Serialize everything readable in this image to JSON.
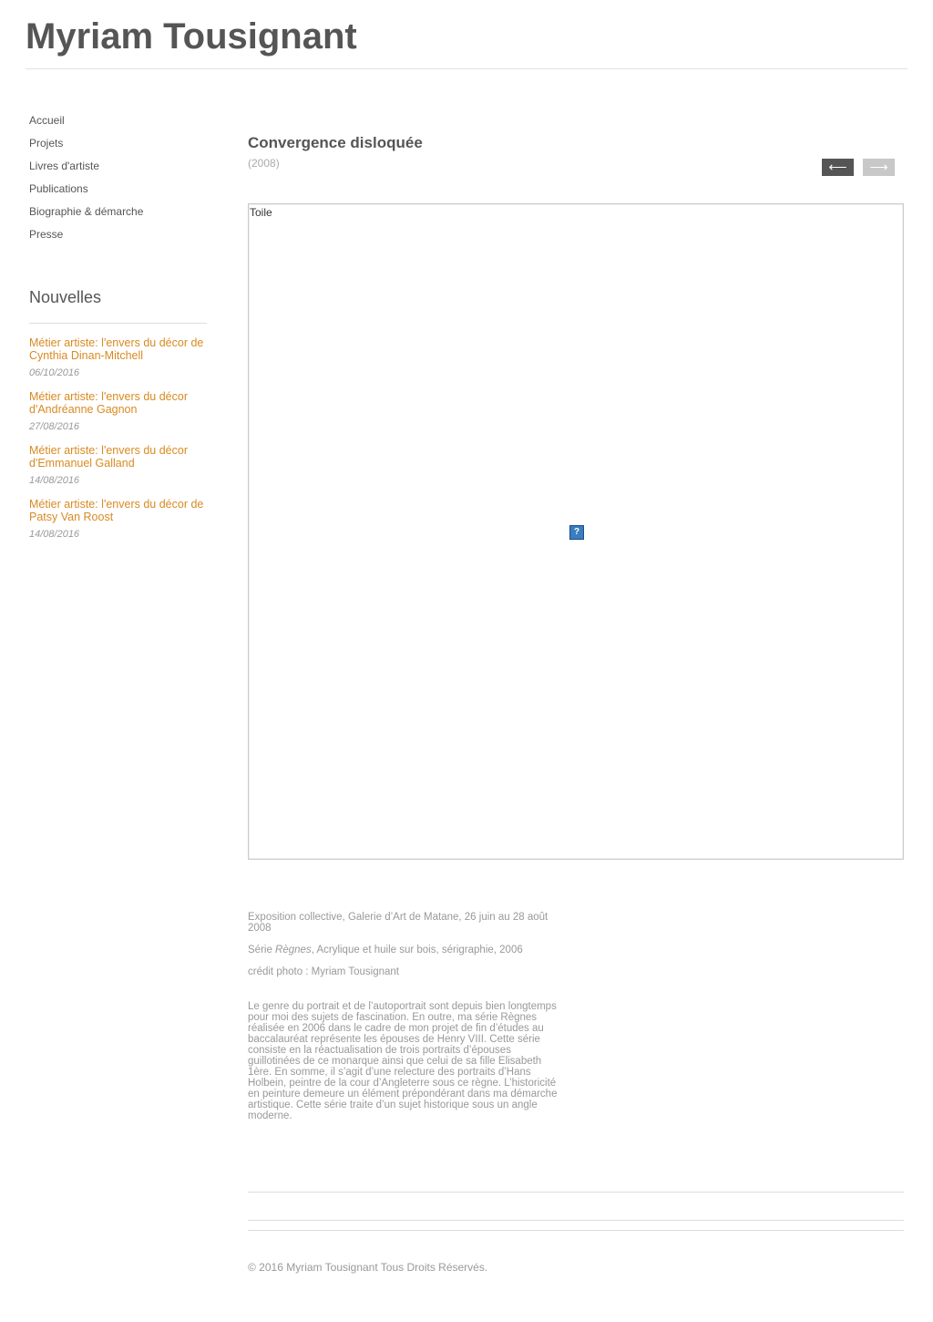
{
  "header": {
    "site_title": "Myriam Tousignant"
  },
  "sidebar": {
    "nav": [
      {
        "label": "Accueil"
      },
      {
        "label": "Projets"
      },
      {
        "label": "Livres d'artiste"
      },
      {
        "label": "Publications"
      },
      {
        "label": "Biographie & démarche"
      },
      {
        "label": "Presse"
      }
    ],
    "news_heading": "Nouvelles",
    "news": [
      {
        "title": "Métier artiste: l'envers du décor de Cynthia Dinan-Mitchell",
        "date": "06/10/2016"
      },
      {
        "title": "Métier artiste: l'envers du décor d'Andréanne Gagnon",
        "date": "27/08/2016"
      },
      {
        "title": "Métier artiste: l'envers du décor d'Emmanuel Galland",
        "date": "14/08/2016"
      },
      {
        "title": "Métier artiste: l'envers du décor de Patsy Van Roost",
        "date": "14/08/2016"
      }
    ]
  },
  "work": {
    "title": "Convergence disloquée",
    "year": "(2008)",
    "prev_arrow": "⟵",
    "next_arrow": "⟶",
    "image_alt": "Toile",
    "broken_image_glyph": "?",
    "exhibition": "Exposition collective, Galerie d’Art de Matane, 26 juin au 28 août 2008",
    "series_prefix": "Série ",
    "series_name": "Règnes",
    "series_suffix": ", Acrylique et huile sur bois, sérigraphie, 2006",
    "credit": "crédit photo : Myriam Tousignant",
    "statement": "Le genre du portrait et de l’autoportrait sont depuis bien longtemps pour moi des sujets de fascination. En outre, ma série Règnes réalisée en 2006 dans le cadre de mon projet de fin d’études au baccalauréat représente les épouses de Henry VIII. Cette série consiste en la réactualisation de trois portraits d’épouses guillotinées de ce monarque ainsi que celui de sa fille Elisabeth 1ère. En somme, il s’agit d’une relecture des portraits d’Hans Holbein, peintre de la cour d’Angleterre sous ce règne. L’historicité en peinture demeure un élément prépondérant dans ma démarche artistique. Cette série traite d’un sujet historique sous un angle moderne."
  },
  "footer": {
    "copyright": "© 2016 Myriam Tousignant Tous Droits Réservés."
  },
  "colors": {
    "accent_link": "#d98a22",
    "text": "#555555",
    "muted": "#999999"
  }
}
